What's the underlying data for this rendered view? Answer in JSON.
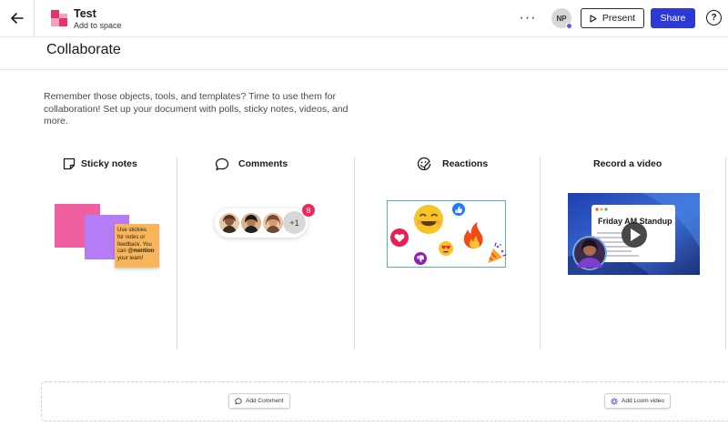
{
  "header": {
    "doc_title": "Test",
    "doc_subtitle": "Add to space",
    "avatar_initials": "NP",
    "present_label": "Present",
    "share_label": "Share",
    "help_label": "?",
    "more_label": "···"
  },
  "section": {
    "title": "Collaborate",
    "intro": "Remember those objects, tools, and templates? Time to use them for collaboration! Set up your document with polls, sticky notes, videos, and more."
  },
  "columns": [
    {
      "label": "Sticky notes",
      "icon": "sticky-note-icon"
    },
    {
      "label": "Comments",
      "icon": "comment-bubble-icon"
    },
    {
      "label": "Reactions",
      "icon": "emoji-sticker-icon"
    },
    {
      "label": "Record a video",
      "icon": ""
    }
  ],
  "sticky": {
    "line1": "Use stickies",
    "line2": "for notes or",
    "line3": "feedback. You",
    "line4": "can ",
    "mention": "@mention",
    "line5": "your team!"
  },
  "comments": {
    "plus_count": "+1",
    "notification_count": "8"
  },
  "video": {
    "title": "Friday AM Standup"
  },
  "dropzone": {
    "add_comment": "Add Comment",
    "add_loom": "Add Loom video"
  },
  "colors": {
    "accent": "#2b39d6",
    "pink": "#f05fa0",
    "purple": "#b57cf5",
    "orange": "#f9b55a",
    "notification": "#ea2a58",
    "selection": "#5aa9e6"
  }
}
